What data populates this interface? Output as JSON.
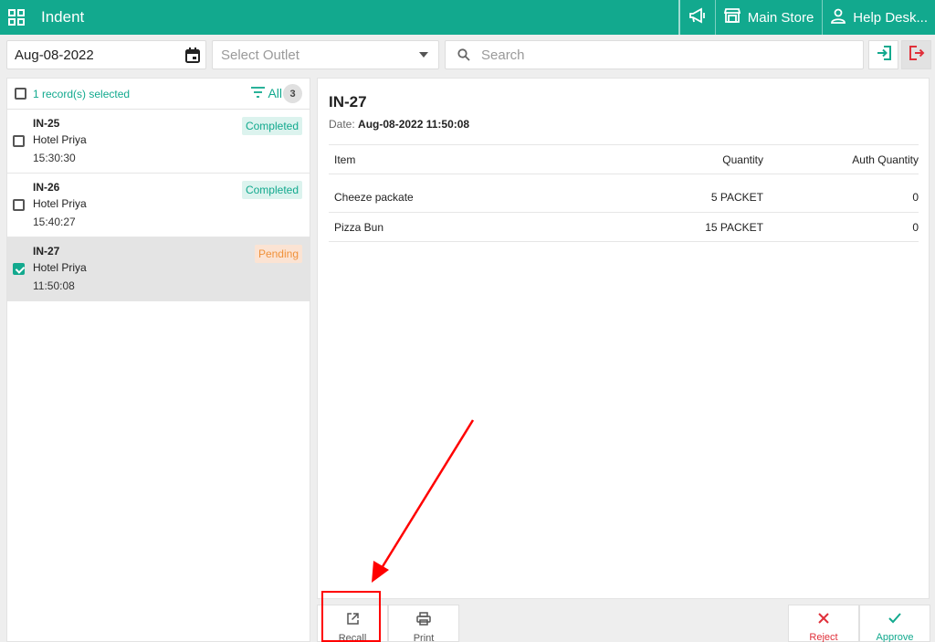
{
  "header": {
    "title": "Indent",
    "store": "Main Store",
    "help": "Help Desk..."
  },
  "toolbar": {
    "date": "Aug-08-2022",
    "outlet_placeholder": "Select Outlet",
    "search_placeholder": "Search"
  },
  "list": {
    "selected_text": "1 record(s) selected",
    "filter_label": "All",
    "count": "3",
    "records": [
      {
        "code": "IN-25",
        "outlet": "Hotel Priya",
        "time": "15:30:30",
        "status": "Completed",
        "checked": false
      },
      {
        "code": "IN-26",
        "outlet": "Hotel Priya",
        "time": "15:40:27",
        "status": "Completed",
        "checked": false
      },
      {
        "code": "IN-27",
        "outlet": "Hotel Priya",
        "time": "11:50:08",
        "status": "Pending",
        "checked": true
      }
    ]
  },
  "detail": {
    "title": "IN-27",
    "date_label": "Date:",
    "date_value": "Aug-08-2022 11:50:08",
    "columns": [
      "Item",
      "Quantity",
      "Auth Quantity"
    ],
    "rows": [
      {
        "item": "Cheeze packate",
        "quantity": "5 PACKET",
        "auth_quantity": "0"
      },
      {
        "item": "Pizza Bun",
        "quantity": "15 PACKET",
        "auth_quantity": "0"
      }
    ]
  },
  "actions": {
    "recall": "Recall",
    "print": "Print",
    "reject": "Reject",
    "approve": "Approve"
  },
  "colors": {
    "brand": "#12a98e",
    "pending": "#f0913a",
    "reject": "#e0303a",
    "annotation": "#ff0000"
  }
}
